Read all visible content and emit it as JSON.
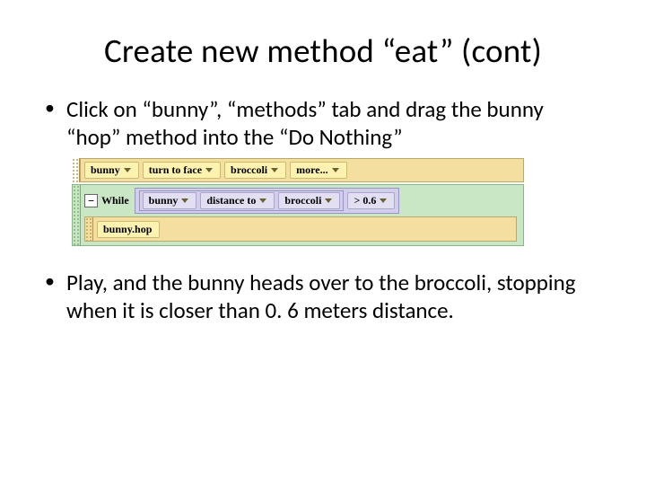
{
  "title": "Create new method “eat” (cont)",
  "bullets": {
    "b1": "Click on “bunny”, “methods” tab and drag the bunny “hop” method into the “Do Nothing”",
    "b2": "Play, and the bunny heads over to the broccoli, stopping when it is closer than 0. 6 meters distance."
  },
  "code": {
    "line1": {
      "p1": "bunny",
      "p2": "turn to face",
      "p3": "broccoli",
      "p4": "more..."
    },
    "while_kw": "While",
    "collapse": "−",
    "cond_outer": {
      "p1": "bunny",
      "p2": "distance to",
      "p3": "broccoli"
    },
    "cond_cmp": "> 0.6",
    "body": "bunny.hop"
  }
}
